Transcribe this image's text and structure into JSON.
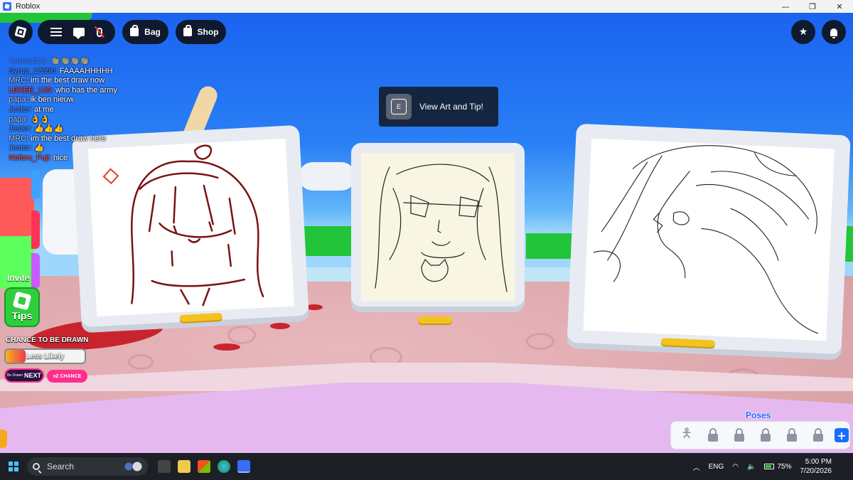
{
  "window": {
    "title": "Roblox",
    "minimize": "—",
    "restore": "❐",
    "close": "✕"
  },
  "topbar": {
    "bag_label": "Bag",
    "shop_label": "Shop"
  },
  "chat": [
    {
      "name": "Tomimi222:",
      "text": "👏👏👏👏",
      "color": "blue",
      "faded": true
    },
    {
      "name": "Syrup_12356:",
      "text": "FAAAAHHHHH",
      "color": "blue"
    },
    {
      "name": "MRC:",
      "text": "im the best draw now",
      "color": ""
    },
    {
      "name": "LBKEE_135:",
      "text": "who has the army",
      "color": "red"
    },
    {
      "name": "papa:",
      "text": "ik ben nieuw",
      "color": ""
    },
    {
      "name": "Jester:",
      "text": "at me",
      "color": "blue"
    },
    {
      "name": "papa:",
      "text": "👌👌",
      "color": ""
    },
    {
      "name": "Jester:",
      "text": "👍👍👍",
      "color": "blue"
    },
    {
      "name": "MRC:",
      "text": "im the best draw here",
      "color": ""
    },
    {
      "name": "Jester:",
      "text": "👍",
      "color": "blue"
    },
    {
      "name": "Nofaru_Fuji:",
      "text": "nice",
      "color": "red"
    }
  ],
  "prompt": {
    "key": "E",
    "text": "View Art and Tip!"
  },
  "side": {
    "invite_label": "Invite",
    "tips_label": "Tips"
  },
  "chance": {
    "title": "CHANCE TO BE DRAWN",
    "level_label": "Less Likely",
    "level_fraction": 0.25,
    "next_small": "Be Drawn",
    "next_big": "NEXT",
    "x2_label": "x2 CHANCE"
  },
  "poses": {
    "title": "Poses",
    "locked_count": 5,
    "add": "+"
  },
  "taskbar": {
    "search_placeholder": "Search",
    "lang": "ENG",
    "battery": "75%",
    "time": "5:00 PM",
    "date": "7/20/2026"
  }
}
